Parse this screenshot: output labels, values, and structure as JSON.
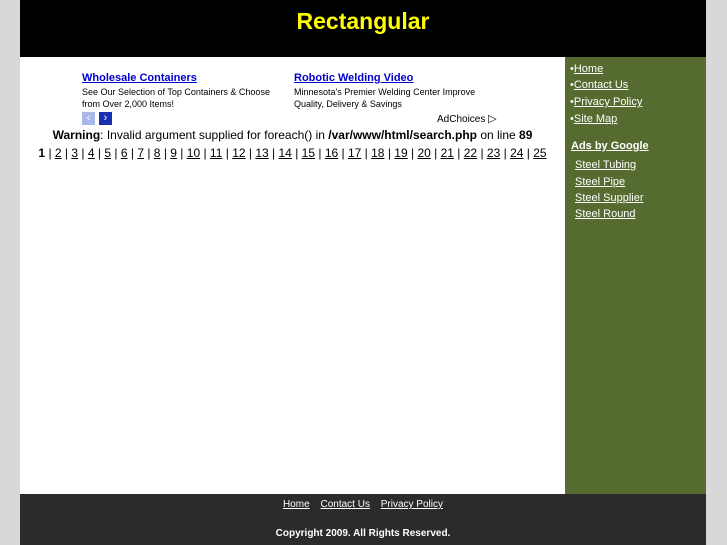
{
  "header": {
    "title": "Rectangular"
  },
  "ads": {
    "ad1": {
      "title": "Wholesale Containers",
      "desc1": "See Our Selection of Top Containers & Choose",
      "desc2": "from Over 2,000 Items!"
    },
    "ad2": {
      "title": "Robotic Welding Video",
      "desc1": "Minnesota's Premier Welding Center Improve",
      "desc2": "Quality, Delivery & Savings"
    },
    "prev_icon": "‹",
    "next_icon": "›",
    "adchoices_label": "AdChoices",
    "adchoices_icon": "▷"
  },
  "warning": {
    "label": "Warning",
    "text1": ": Invalid argument supplied for foreach() in ",
    "path": "/var/www/html/search.php",
    "text2": " on line ",
    "line": "89"
  },
  "pager": {
    "current": "1",
    "pages": [
      "2",
      "3",
      "4",
      "5",
      "6",
      "7",
      "8",
      "9",
      "10",
      "11",
      "12",
      "13",
      "14",
      "15",
      "16",
      "17",
      "18",
      "19",
      "20",
      "21",
      "22",
      "23",
      "24",
      "25"
    ]
  },
  "sidebar": {
    "links": [
      {
        "bullet": "•",
        "label": "Home"
      },
      {
        "bullet": "•",
        "label": "Contact Us"
      },
      {
        "bullet": "•",
        "label": "Privacy Policy"
      },
      {
        "bullet": "•",
        "label": "Site Map"
      }
    ],
    "ads_by_google": "Ads by Google",
    "google_links": [
      "Steel Tubing",
      "Steel Pipe",
      "Steel Supplier",
      "Steel Round"
    ]
  },
  "footer": {
    "links": [
      "Home",
      "Contact Us",
      "Privacy Policy"
    ],
    "copyright": "Copyright 2009. All Rights Reserved."
  },
  "colors": {
    "header_bg": "#000000",
    "title": "#ffff00",
    "sidebar_bg": "#556b2f",
    "footer_bg": "#2b2b2b",
    "ad_link": "#0000cc"
  }
}
